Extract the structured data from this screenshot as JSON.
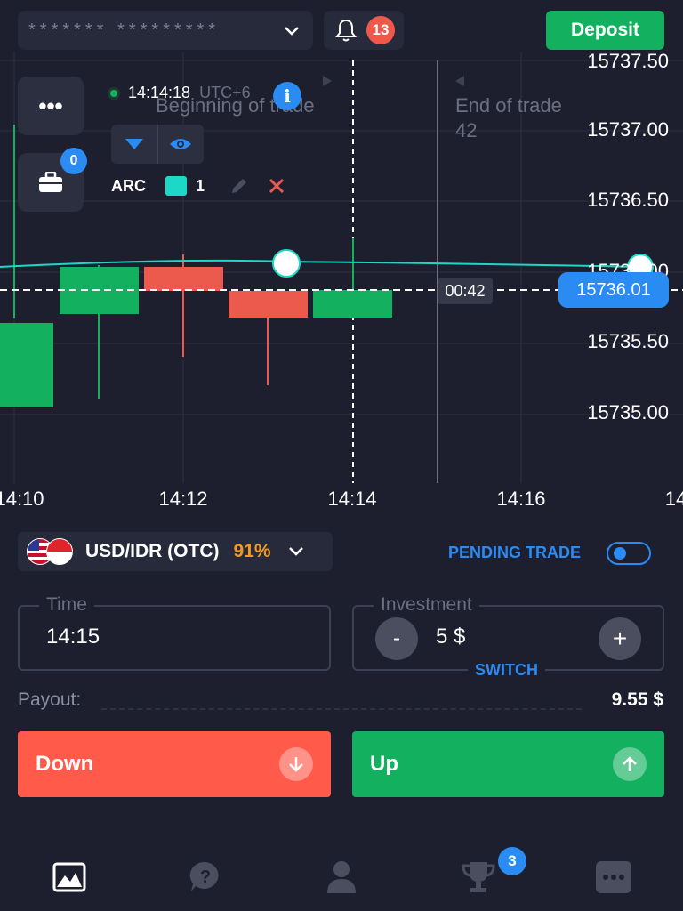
{
  "header": {
    "account_masked": "*******  *********",
    "notification_count": "13",
    "deposit_label": "Deposit"
  },
  "chart": {
    "clock": "14:14:18",
    "timezone": "UTC+6",
    "beginning_label": "Beginning of trade",
    "end_label": "End of trade",
    "end_value": "42",
    "portfolio_count": "0",
    "indicator_name": "ARC",
    "indicator_period": "1",
    "price_labels": [
      "15737.50",
      "15737.00",
      "15736.50",
      "15736.00",
      "15735.50",
      "15735.00"
    ],
    "time_labels": [
      "14:10",
      "14:12",
      "14:14",
      "14:16",
      "14"
    ],
    "countdown": "00:42",
    "current_price": "15736.01",
    "colors": {
      "up": "#13b060",
      "down": "#ec5a4d",
      "indicator": "#1dd8c6",
      "accent": "#2a8bf2"
    }
  },
  "asset": {
    "name": "USD/IDR (OTC)",
    "payout_percent": "91%",
    "pending_label": "PENDING TRADE"
  },
  "form": {
    "time_label": "Time",
    "time_value": "14:15",
    "investment_label": "Investment",
    "investment_value": "5 $",
    "minus": "-",
    "plus": "+",
    "switch_label": "SWITCH",
    "payout_label": "Payout:",
    "payout_value": "9.55 $"
  },
  "actions": {
    "down_label": "Down",
    "up_label": "Up"
  },
  "nav": {
    "items": [
      "chart-icon",
      "help-icon",
      "profile-icon",
      "trophy-icon",
      "chat-icon"
    ],
    "trophy_badge": "3"
  }
}
